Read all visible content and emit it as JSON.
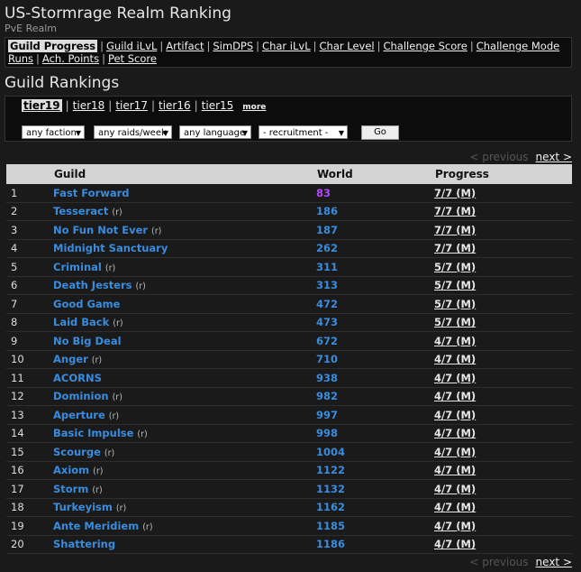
{
  "header": {
    "title": "US-Stormrage Realm Ranking",
    "subtitle": "PvE Realm"
  },
  "nav": {
    "items": [
      {
        "label": "Guild Progress",
        "selected": true
      },
      {
        "label": "Guild iLvL"
      },
      {
        "label": "Artifact"
      },
      {
        "label": "SimDPS"
      },
      {
        "label": "Char iLvL"
      },
      {
        "label": "Char Level"
      },
      {
        "label": "Challenge Score"
      },
      {
        "label": "Challenge Mode Runs"
      },
      {
        "label": "Ach. Points"
      },
      {
        "label": "Pet Score"
      }
    ]
  },
  "section_title": "Guild Rankings",
  "tiers": {
    "items": [
      "tier19",
      "tier18",
      "tier17",
      "tier16",
      "tier15"
    ],
    "selected": "tier19",
    "more": "more"
  },
  "filters": {
    "faction": "any faction",
    "raids": "any raids/week",
    "language": "any language",
    "recruitment": "- recruitment -",
    "go": "Go"
  },
  "pager": {
    "previous": "< previous",
    "next": "next >"
  },
  "table": {
    "headers": {
      "guild": "Guild",
      "world": "World",
      "progress": "Progress"
    },
    "rows": [
      {
        "rank": "1",
        "guild": "Fast Forward",
        "tag": "",
        "world": "83",
        "progress": "7/7 (M)"
      },
      {
        "rank": "2",
        "guild": "Tesseract",
        "tag": "(r)",
        "world": "186",
        "progress": "7/7 (M)"
      },
      {
        "rank": "3",
        "guild": "No Fun Not Ever",
        "tag": "(r)",
        "world": "187",
        "progress": "7/7 (M)"
      },
      {
        "rank": "4",
        "guild": "Midnight Sanctuary",
        "tag": "",
        "world": "262",
        "progress": "7/7 (M)"
      },
      {
        "rank": "5",
        "guild": "Criminal",
        "tag": "(r)",
        "world": "311",
        "progress": "5/7 (M)"
      },
      {
        "rank": "6",
        "guild": "Death Jesters",
        "tag": "(r)",
        "world": "313",
        "progress": "5/7 (M)"
      },
      {
        "rank": "7",
        "guild": "Good Game",
        "tag": "",
        "world": "472",
        "progress": "5/7 (M)"
      },
      {
        "rank": "8",
        "guild": "Laid Back",
        "tag": "(r)",
        "world": "473",
        "progress": "5/7 (M)"
      },
      {
        "rank": "9",
        "guild": "No Big Deal",
        "tag": "",
        "world": "672",
        "progress": "4/7 (M)"
      },
      {
        "rank": "10",
        "guild": "Anger",
        "tag": "(r)",
        "world": "710",
        "progress": "4/7 (M)"
      },
      {
        "rank": "11",
        "guild": "ACORNS",
        "tag": "",
        "world": "938",
        "progress": "4/7 (M)"
      },
      {
        "rank": "12",
        "guild": "Dominion",
        "tag": "(r)",
        "world": "982",
        "progress": "4/7 (M)"
      },
      {
        "rank": "13",
        "guild": "Aperture",
        "tag": "(r)",
        "world": "997",
        "progress": "4/7 (M)"
      },
      {
        "rank": "14",
        "guild": "Basic Impulse",
        "tag": "(r)",
        "world": "998",
        "progress": "4/7 (M)"
      },
      {
        "rank": "15",
        "guild": "Scourge",
        "tag": "(r)",
        "world": "1004",
        "progress": "4/7 (M)"
      },
      {
        "rank": "16",
        "guild": "Axiom",
        "tag": "(r)",
        "world": "1122",
        "progress": "4/7 (M)"
      },
      {
        "rank": "17",
        "guild": "Storm",
        "tag": "(r)",
        "world": "1132",
        "progress": "4/7 (M)"
      },
      {
        "rank": "18",
        "guild": "Turkeyism",
        "tag": "(r)",
        "world": "1162",
        "progress": "4/7 (M)"
      },
      {
        "rank": "19",
        "guild": "Ante Meridiem",
        "tag": "(r)",
        "world": "1185",
        "progress": "4/7 (M)"
      },
      {
        "rank": "20",
        "guild": "Shattering",
        "tag": "",
        "world": "1186",
        "progress": "4/7 (M)"
      }
    ]
  },
  "colors": {
    "link": "#3a8cde",
    "top_world": "#b048ff",
    "background": "#1a1a1a"
  }
}
